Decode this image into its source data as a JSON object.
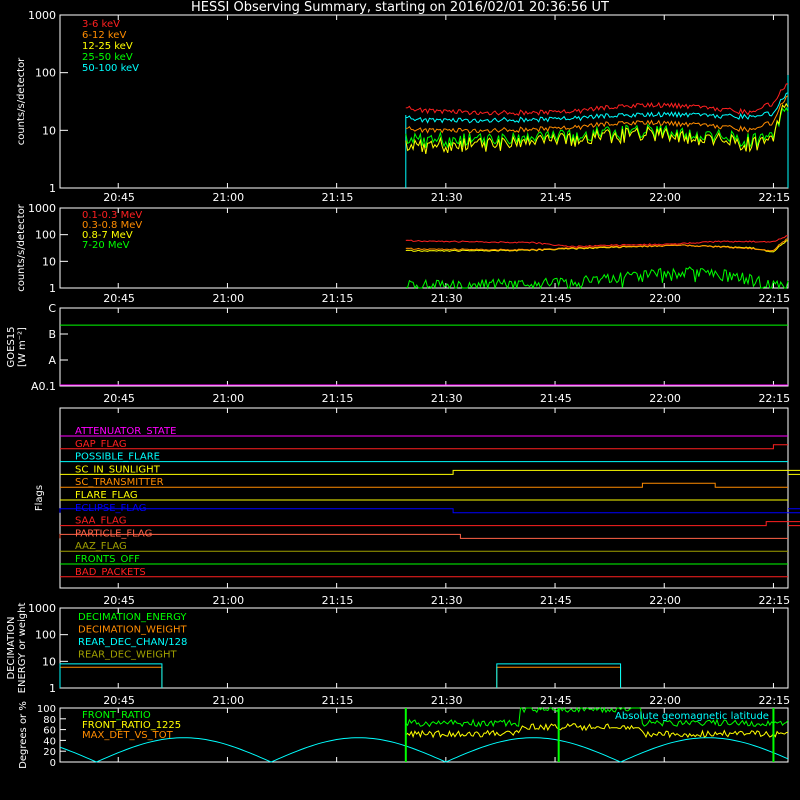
{
  "title": "HESSI Observing Summary, starting on 2016/02/01 20:36:56 UT",
  "colors": {
    "red": "#ff2020",
    "orange": "#ff8c00",
    "yellow": "#ffff00",
    "green": "#00ff00",
    "cyan": "#00ffff",
    "blue": "#0000ff",
    "magenta": "#ff00ff",
    "olive": "#a0a000",
    "salmon": "#ff6347",
    "white": "#ffffff",
    "teal": "#00bfbf"
  },
  "chart_data": [
    {
      "id": "lo-energy",
      "type": "line",
      "ylabel": "counts/s/detector",
      "yscale": "log",
      "ylim": [
        1,
        1000
      ],
      "yticks": [
        "1",
        "10",
        "100",
        "1000"
      ],
      "xticks": [
        "20:45",
        "21:00",
        "21:15",
        "21:30",
        "21:45",
        "22:00",
        "22:15"
      ],
      "series": [
        {
          "name": "3-6 keV",
          "color": "#ff2020",
          "x": [
            47,
            50,
            60,
            70,
            75,
            80,
            85,
            90,
            95,
            98,
            100
          ],
          "y": [
            25,
            22,
            20,
            21,
            25,
            28,
            27,
            24,
            20,
            30,
            65
          ]
        },
        {
          "name": "6-12 keV",
          "color": "#ff8c00",
          "x": [
            47,
            50,
            60,
            70,
            75,
            80,
            85,
            90,
            95,
            98,
            100
          ],
          "y": [
            11,
            10,
            10,
            11,
            13,
            14,
            13,
            12,
            10,
            14,
            40
          ]
        },
        {
          "name": "12-25 keV",
          "color": "#ffff00",
          "x": [
            47,
            50,
            60,
            70,
            75,
            80,
            85,
            90,
            95,
            98,
            100
          ],
          "y": [
            6,
            5.5,
            6,
            7,
            8,
            9,
            8,
            7,
            6,
            7,
            30
          ]
        },
        {
          "name": "25-50 keV",
          "color": "#00ff00",
          "x": [
            47,
            50,
            60,
            70,
            75,
            80,
            85,
            90,
            95,
            98,
            100
          ],
          "y": [
            8,
            7,
            7,
            8,
            9,
            10,
            9,
            8,
            7,
            8,
            25
          ]
        },
        {
          "name": "50-100 keV",
          "color": "#00ffff",
          "x": [
            47,
            50,
            60,
            70,
            75,
            80,
            85,
            90,
            95,
            98,
            100
          ],
          "y": [
            17,
            15,
            15,
            16,
            18,
            19,
            19,
            18,
            17,
            20,
            45
          ]
        }
      ]
    },
    {
      "id": "hi-energy",
      "type": "line",
      "ylabel": "counts/s/detector",
      "yscale": "log",
      "ylim": [
        1,
        1000
      ],
      "yticks": [
        "1",
        "10",
        "100",
        "1000"
      ],
      "xticks": [
        "20:45",
        "21:00",
        "21:15",
        "21:30",
        "21:45",
        "22:00",
        "22:15"
      ],
      "series": [
        {
          "name": "0.1-0.3 MeV",
          "color": "#ff2020",
          "x": [
            47,
            55,
            65,
            70,
            75,
            85,
            90,
            95,
            98,
            100
          ],
          "y": [
            60,
            55,
            50,
            35,
            40,
            45,
            55,
            55,
            55,
            90
          ]
        },
        {
          "name": "0.3-0.8 MeV",
          "color": "#ff8c00",
          "x": [
            47,
            55,
            65,
            75,
            85,
            95,
            98,
            100
          ],
          "y": [
            30,
            28,
            27,
            35,
            40,
            30,
            25,
            70
          ]
        },
        {
          "name": "0.8-7 MeV",
          "color": "#ffff00",
          "x": [
            47,
            55,
            65,
            75,
            85,
            95,
            98,
            100
          ],
          "y": [
            25,
            25,
            26,
            33,
            40,
            32,
            22,
            60
          ]
        },
        {
          "name": "7-20 MeV",
          "color": "#00ff00",
          "x": [
            47,
            55,
            65,
            75,
            80,
            85,
            90,
            95,
            98,
            100
          ],
          "y": [
            1.2,
            1.3,
            1.4,
            2,
            3,
            4,
            3.5,
            2,
            1.3,
            1.2
          ]
        }
      ]
    },
    {
      "id": "goes",
      "type": "line",
      "ylabel": "GOES15",
      "ylabel2": "[W m⁻²]",
      "yticks": [
        "A0.1",
        "A",
        "B",
        "C"
      ],
      "xticks": [
        "20:45",
        "21:00",
        "21:15",
        "21:30",
        "21:45",
        "22:00",
        "22:15"
      ],
      "series": [
        {
          "name": "GOES long",
          "color": "#00ff00",
          "level": 0.78
        },
        {
          "name": "GOES short",
          "color": "#ff00ff",
          "level": 0.0
        }
      ]
    },
    {
      "id": "flags",
      "type": "line",
      "ylabel": "Flags",
      "xticks": [
        "20:45",
        "21:00",
        "21:15",
        "21:30",
        "21:45",
        "22:00",
        "22:15"
      ],
      "series": [
        {
          "name": "ATTENUATOR_STATE",
          "color": "#ff00ff",
          "steps": []
        },
        {
          "name": "GAP_FLAG",
          "color": "#ff2020",
          "steps": [
            [
              98,
              1
            ]
          ]
        },
        {
          "name": "POSSIBLE_FLARE",
          "color": "#00ffff",
          "steps": []
        },
        {
          "name": "SC_IN_SUNLIGHT",
          "color": "#ffff00",
          "steps": [
            [
              54,
              1
            ],
            [
              104,
              0
            ]
          ]
        },
        {
          "name": "SC_TRANSMITTER",
          "color": "#ff8c00",
          "steps": [
            [
              80,
              1
            ],
            [
              90,
              0
            ]
          ]
        },
        {
          "name": "FLARE_FLAG",
          "color": "#ffff00",
          "steps": []
        },
        {
          "name": "ECLIPSE_FLAG",
          "color": "#0000ff",
          "steps": [
            [
              0,
              1
            ],
            [
              54,
              0
            ],
            [
              104,
              1
            ]
          ]
        },
        {
          "name": "SAA_FLAG",
          "color": "#ff2020",
          "steps": [
            [
              97,
              1
            ],
            [
              115,
              0
            ]
          ]
        },
        {
          "name": "PARTICLE_FLAG",
          "color": "#ff6347",
          "steps": [
            [
              0,
              1
            ],
            [
              55,
              0
            ]
          ]
        },
        {
          "name": "AAZ_FLAG",
          "color": "#a0a000",
          "steps": []
        },
        {
          "name": "FRONTS_OFF",
          "color": "#00ff00",
          "steps": []
        },
        {
          "name": "BAD_PACKETS",
          "color": "#ff2020",
          "steps": []
        }
      ]
    },
    {
      "id": "decimation",
      "type": "line",
      "ylabel": "DECIMATION",
      "ylabel2": "ENERGY or weight",
      "yscale": "log",
      "ylim": [
        1,
        1000
      ],
      "yticks": [
        "1",
        "10",
        "100",
        "1000"
      ],
      "xticks": [
        "20:45",
        "21:00",
        "21:15",
        "21:30",
        "21:45",
        "22:00",
        "22:15"
      ],
      "series": [
        {
          "name": "DECIMATION_ENERGY",
          "color": "#00ff00",
          "segments": []
        },
        {
          "name": "DECIMATION_WEIGHT",
          "color": "#ff8c00",
          "segments": [
            [
              0,
              14,
              6
            ],
            [
              60,
              77,
              6
            ],
            [
              117,
              118,
              6
            ]
          ]
        },
        {
          "name": "REAR_DEC_CHAN/128",
          "color": "#00ffff",
          "segments": [
            [
              0,
              14,
              8
            ],
            [
              60,
              77,
              8
            ],
            [
              117,
              118,
              8
            ]
          ]
        },
        {
          "name": "REAR_DEC_WEIGHT",
          "color": "#a0a000",
          "segments": []
        }
      ]
    },
    {
      "id": "ratios",
      "type": "line",
      "ylabel": "Degrees or %",
      "ylim": [
        0,
        100
      ],
      "yticks": [
        "0",
        "20",
        "40",
        "60",
        "80",
        "100"
      ],
      "annotation": "Absolute geomagnetic latitude",
      "series": [
        {
          "name": "FRONT_RATIO",
          "color": "#00ff00"
        },
        {
          "name": "FRONT_RATIO_1225",
          "color": "#ffff00"
        },
        {
          "name": "MAX_DET_VS_TOT",
          "color": "#ff8c00"
        }
      ]
    }
  ]
}
